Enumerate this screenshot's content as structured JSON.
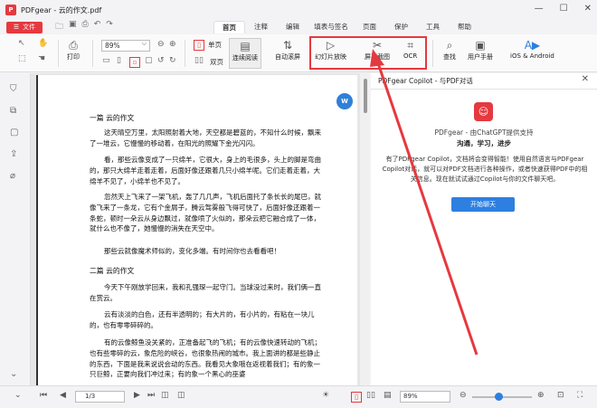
{
  "window": {
    "title": "PDFgear - 云的作文.pdf",
    "logo": "P"
  },
  "menu": {
    "file": "文件",
    "tabs": [
      "首页",
      "注释",
      "编辑",
      "填表与签名",
      "页面",
      "保护",
      "工具",
      "帮助"
    ]
  },
  "toolbar": {
    "print": "打印",
    "zoom": "89%",
    "single": "单页",
    "double": "双页",
    "continuous": "连续阅读",
    "auto_scroll": "自动滚屏",
    "slideshow": "幻灯片放映",
    "screenshot": "屏幕截图",
    "ocr": "OCR",
    "search": "查找",
    "manual": "用户手册",
    "ios_android": "iOS & Android"
  },
  "copilot": {
    "title": "PDFgear Copilot - 与PDF对话",
    "brand": "PDFgear - 由ChatGPT提供支持",
    "tagline": "沟通，学习，进步",
    "desc": "有了PDFgear Copilot，文档将会变得智能！使用自然语言与PDFgear Copilot对话，就可以对PDF文档进行各种操作，或者快速获得PDF中的相关信息。现在就试试通过Copilot与你的文件聊天吧。",
    "start": "开始聊天"
  },
  "document": {
    "paragraphs": [
      "一篇 云的作文",
      "这天晴空万里，太阳照射着大地，天空都是碧蓝的，不知什么时候，飘来了一堆云，它慢慢的移动着，在阳光的照耀下金光闪闪。",
      "看，那些云像变成了一只绵羊，它很大，身上的毛很多，头上的脚是弯曲的，那只大绵羊走着走着，后面好像还跟着几只小绵羊呢。它们走着走着，大绵羊不见了，小绵羊也不见了。",
      "忽然天上飞来了一架飞机，轰了几几声，飞机后面托了条长长的尾巴，就像飞来了一条龙，它有个金屑子，腾云驾雾般飞得可快了，后面好像还跟着一条蛇，顿时一朵云从身边飘过，就像喷了火似的，那朵云把它融合成了一体，就什么也不像了，她慢慢的消失在天空中。",
      "那些云就像魔术师似的，变化多端。有时间你也去看看吧！",
      "二篇 云的作文",
      "今天下午刚放学回来，我和孔强琛一起守门。当球没过来时，我们俩一直在赏云。",
      "云有淡淡的白色，还有半透明的；有大片的，有小片的，有粘在一块儿的，也有零零碎碎的。",
      "有的云像鲸鱼没关紧的，正准备起飞的飞机；有的云像快速转动的飞机；也有些零碎的云，象危险的峡谷，也很象热闹的城市。我上面讲的都是些静止的东西，下面是我来说说会动的东西。我看见大象哦在返视着我们；有的象一只巨鲸，正要向我们冲过来；有的象一个黑心的巫婆"
    ]
  },
  "status": {
    "page": "1/3",
    "zoom": "89%"
  }
}
